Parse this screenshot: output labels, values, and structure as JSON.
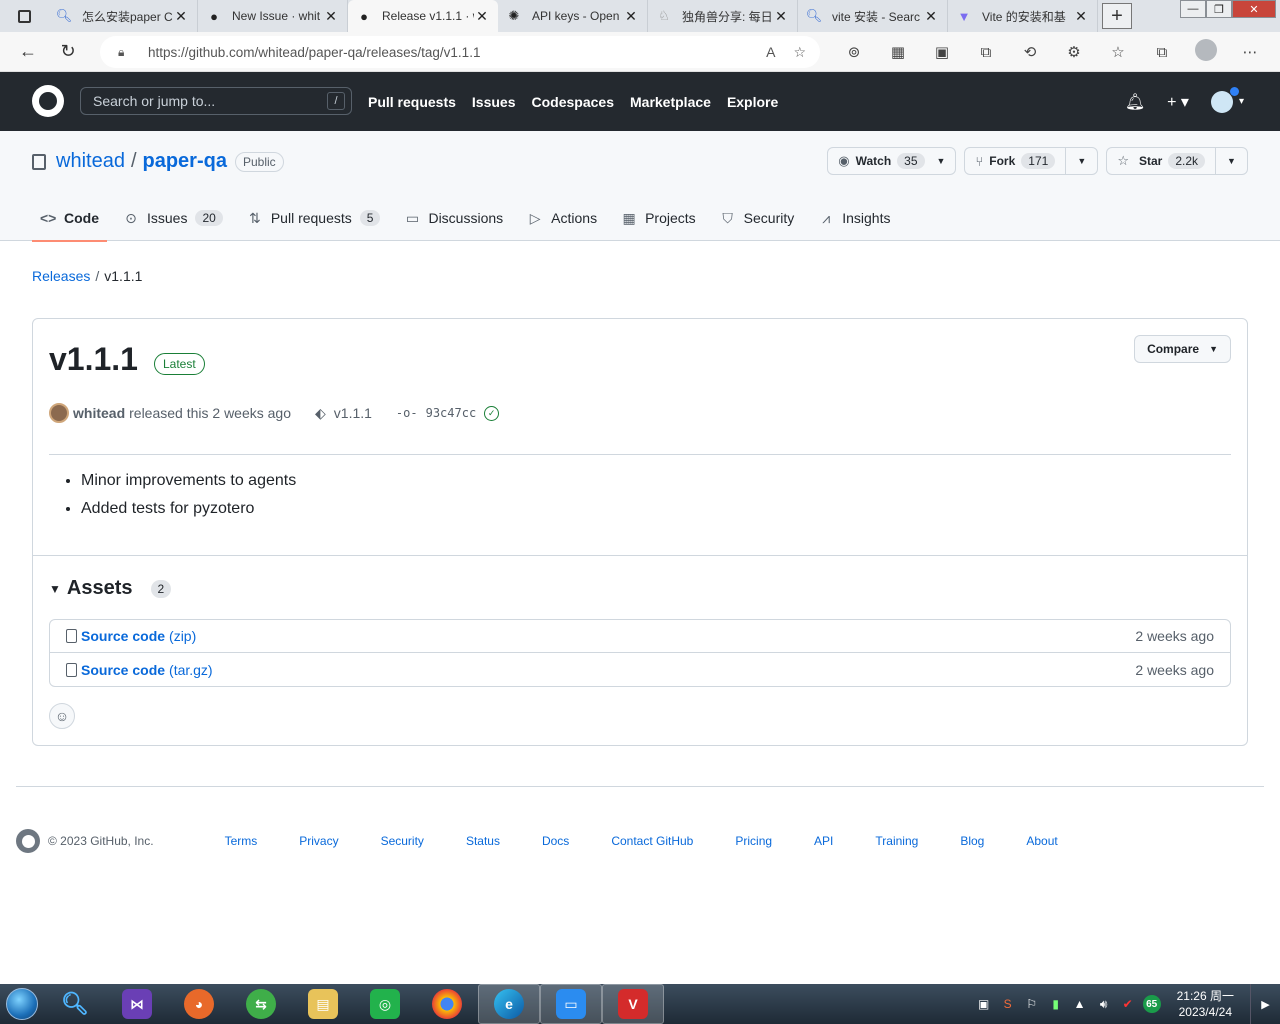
{
  "browser": {
    "tabs": [
      {
        "title": "怎么安装paper C",
        "icon": "search-icon"
      },
      {
        "title": "New Issue · whit",
        "icon": "github-icon"
      },
      {
        "title": "Release v1.1.1 · w",
        "icon": "github-icon",
        "active": true
      },
      {
        "title": "API keys - Open",
        "icon": "openai-icon"
      },
      {
        "title": "独角兽分享: 每日",
        "icon": "unicorn-icon"
      },
      {
        "title": "vite 安装 - Searc",
        "icon": "search-icon"
      },
      {
        "title": "Vite 的安装和基",
        "icon": "vite-icon"
      }
    ],
    "url": "https://github.com/whitead/paper-qa/releases/tag/v1.1.1"
  },
  "gh_header": {
    "search_placeholder": "Search or jump to...",
    "search_shortcut": "/",
    "nav": [
      "Pull requests",
      "Issues",
      "Codespaces",
      "Marketplace",
      "Explore"
    ]
  },
  "repo": {
    "owner": "whitead",
    "name": "paper-qa",
    "visibility": "Public",
    "watch_label": "Watch",
    "watch_count": "35",
    "fork_label": "Fork",
    "fork_count": "171",
    "star_label": "Star",
    "star_count": "2.2k",
    "tabs": [
      {
        "label": "Code",
        "icon": "code-icon",
        "count": ""
      },
      {
        "label": "Issues",
        "icon": "issue-icon",
        "count": "20"
      },
      {
        "label": "Pull requests",
        "icon": "pull-request-icon",
        "count": "5"
      },
      {
        "label": "Discussions",
        "icon": "discussion-icon",
        "count": ""
      },
      {
        "label": "Actions",
        "icon": "play-icon",
        "count": ""
      },
      {
        "label": "Projects",
        "icon": "table-icon",
        "count": ""
      },
      {
        "label": "Security",
        "icon": "shield-icon",
        "count": ""
      },
      {
        "label": "Insights",
        "icon": "graph-icon",
        "count": ""
      }
    ]
  },
  "breadcrumb": {
    "releases": "Releases",
    "current": "v1.1.1"
  },
  "release": {
    "title": "v1.1.1",
    "latest_badge": "Latest",
    "compare_label": "Compare",
    "author": "whitead",
    "released_text": "released this 2 weeks ago",
    "tag": "v1.1.1",
    "commit": "93c47cc",
    "notes": [
      "Minor improvements to agents",
      "Added tests for pyzotero"
    ],
    "assets_title": "Assets",
    "assets_count": "2",
    "assets": [
      {
        "name": "Source code",
        "suffix": "(zip)",
        "date": "2 weeks ago"
      },
      {
        "name": "Source code",
        "suffix": "(tar.gz)",
        "date": "2 weeks ago"
      }
    ]
  },
  "footer": {
    "copyright": "© 2023 GitHub, Inc.",
    "links": [
      "Terms",
      "Privacy",
      "Security",
      "Status",
      "Docs",
      "Contact GitHub",
      "Pricing",
      "API",
      "Training",
      "Blog",
      "About"
    ]
  },
  "taskbar": {
    "time": "21:26 周一",
    "date": "2023/4/24",
    "battery_badge": "65"
  }
}
